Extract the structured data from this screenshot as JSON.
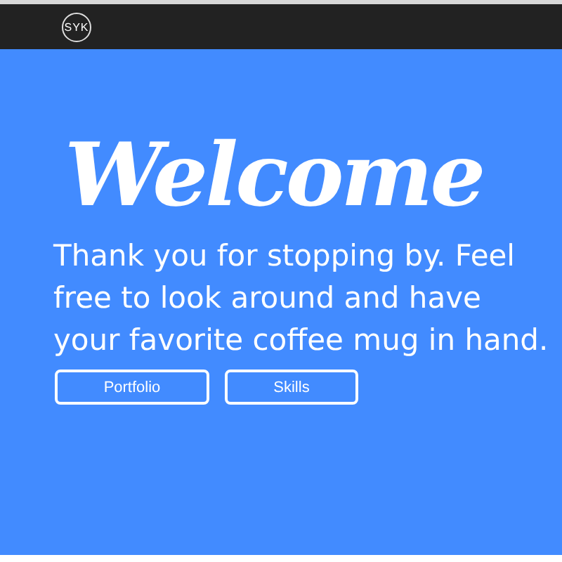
{
  "navbar": {
    "logo": "SYK"
  },
  "hero": {
    "heading": "Welcome",
    "text": "Thank you for stopping by. Feel free to look around and have your favorite coffee mug in hand.",
    "buttons": [
      "Portfolio",
      "Skills"
    ]
  }
}
